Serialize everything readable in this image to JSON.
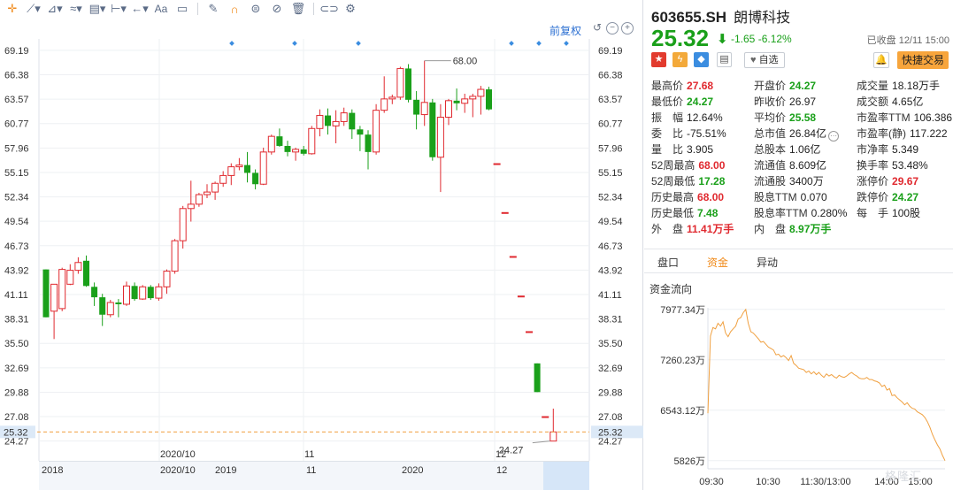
{
  "toolbar": {
    "text_tool": "Aa"
  },
  "chart": {
    "fuquan_label": "前复权",
    "high_label": "68.00",
    "low_label": "24.27",
    "current_price_label": "25.32",
    "up_color": "#e0292f",
    "down_color": "#1aa01a",
    "current_line_color": "#f0a040"
  },
  "timeline": {
    "labels": [
      "2018",
      "2020/10",
      "2019",
      "11",
      "2020",
      "12"
    ]
  },
  "chart_data": {
    "type": "candlestick",
    "y_ticks": [
      "69.19",
      "66.38",
      "63.57",
      "60.77",
      "57.96",
      "55.15",
      "52.34",
      "49.54",
      "46.73",
      "43.92",
      "41.11",
      "38.31",
      "35.50",
      "32.69",
      "29.88",
      "27.08",
      "24.27"
    ],
    "ylim": [
      22.0,
      70.5
    ],
    "x_ticks": [
      "2020/10",
      "11",
      "12"
    ],
    "ohlc": [
      [
        44.0,
        44.0,
        38.5,
        38.5
      ],
      [
        39.2,
        39.5,
        36.0,
        42.3
      ],
      [
        39.5,
        44.2,
        39.2,
        44.0
      ],
      [
        42.3,
        44.6,
        42.2,
        43.9
      ],
      [
        43.9,
        45.4,
        43.5,
        44.8
      ],
      [
        45.0,
        45.6,
        42.0,
        42.1
      ],
      [
        42.0,
        42.5,
        39.8,
        40.8
      ],
      [
        40.8,
        41.2,
        37.5,
        38.8
      ],
      [
        38.8,
        40.5,
        38.5,
        40.2
      ],
      [
        40.2,
        40.6,
        38.5,
        40.0
      ],
      [
        40.0,
        42.6,
        39.8,
        42.1
      ],
      [
        42.1,
        42.5,
        40.4,
        40.6
      ],
      [
        40.6,
        42.2,
        40.5,
        42.0
      ],
      [
        42.0,
        42.2,
        40.5,
        40.7
      ],
      [
        40.7,
        42.4,
        40.4,
        42.0
      ],
      [
        42.0,
        44.0,
        41.2,
        43.8
      ],
      [
        43.8,
        47.5,
        43.5,
        47.3
      ],
      [
        47.3,
        51.3,
        46.4,
        51.0
      ],
      [
        51.0,
        54.2,
        49.5,
        51.5
      ],
      [
        51.5,
        52.8,
        51.2,
        52.6
      ],
      [
        52.6,
        53.8,
        52.2,
        52.9
      ],
      [
        52.9,
        54.1,
        52.0,
        53.9
      ],
      [
        53.9,
        55.3,
        53.5,
        54.8
      ],
      [
        54.8,
        56.2,
        53.7,
        55.8
      ],
      [
        55.8,
        56.8,
        55.4,
        56.0
      ],
      [
        56.0,
        57.5,
        54.0,
        55.1
      ],
      [
        55.1,
        55.5,
        53.2,
        53.8
      ],
      [
        53.8,
        58.0,
        53.7,
        57.5
      ],
      [
        57.5,
        59.5,
        57.2,
        59.3
      ],
      [
        59.3,
        60.2,
        58.1,
        58.2
      ],
      [
        58.2,
        58.8,
        57.0,
        57.5
      ],
      [
        57.5,
        58.0,
        56.5,
        57.8
      ],
      [
        57.8,
        58.2,
        57.1,
        57.3
      ],
      [
        57.3,
        60.5,
        57.2,
        60.2
      ],
      [
        60.2,
        62.4,
        59.3,
        61.7
      ],
      [
        61.7,
        62.5,
        59.5,
        60.5
      ],
      [
        60.5,
        62.3,
        58.5,
        61.0
      ],
      [
        61.0,
        62.6,
        60.5,
        62.0
      ],
      [
        62.0,
        62.4,
        59.0,
        60.1
      ],
      [
        60.1,
        60.5,
        57.6,
        59.5
      ],
      [
        59.5,
        60.0,
        55.5,
        57.5
      ],
      [
        57.5,
        63.0,
        57.2,
        62.3
      ],
      [
        62.3,
        66.2,
        62.0,
        63.6
      ],
      [
        63.6,
        64.1,
        63.0,
        63.8
      ],
      [
        63.8,
        67.3,
        63.5,
        67.1
      ],
      [
        67.1,
        67.6,
        63.2,
        63.5
      ],
      [
        63.5,
        64.5,
        60.1,
        61.8
      ],
      [
        61.8,
        68.0,
        60.5,
        63.2
      ],
      [
        63.2,
        63.6,
        56.5,
        56.9
      ],
      [
        56.9,
        63.0,
        52.9,
        61.5
      ],
      [
        61.5,
        63.6,
        60.6,
        63.4
      ],
      [
        63.4,
        64.8,
        62.3,
        63.1
      ],
      [
        63.1,
        64.2,
        62.0,
        63.6
      ],
      [
        63.6,
        64.2,
        61.5,
        63.9
      ],
      [
        63.9,
        65.1,
        61.8,
        64.7
      ],
      [
        64.7,
        65.0,
        62.3,
        62.4
      ],
      [
        56.16,
        56.16,
        56.16,
        56.16
      ],
      [
        50.54,
        50.54,
        50.54,
        50.54
      ],
      [
        45.49,
        45.49,
        45.49,
        45.49
      ],
      [
        40.94,
        40.94,
        40.94,
        40.94
      ],
      [
        36.85,
        36.85,
        36.85,
        36.85
      ],
      [
        33.2,
        33.2,
        29.9,
        29.9
      ],
      [
        27.08,
        27.08,
        27.08,
        27.08
      ],
      [
        24.27,
        28.0,
        24.27,
        25.32
      ]
    ]
  },
  "quote": {
    "code": "603655.SH",
    "name": "朗博科技",
    "price": "25.32",
    "change": "-1.65",
    "change_pct": "-6.12%",
    "status": "已收盘 12/11 15:00",
    "zixuan": "自选",
    "quick_trade": "快捷交易",
    "rows": [
      [
        [
          "最高价",
          "27.68",
          "red"
        ],
        [
          "开盘价",
          "24.27",
          "green"
        ],
        [
          "成交量",
          "18.18万手",
          "dark"
        ]
      ],
      [
        [
          "最低价",
          "24.27",
          "green"
        ],
        [
          "昨收价",
          "26.97",
          "dark"
        ],
        [
          "成交额",
          "4.65亿",
          "dark"
        ]
      ],
      [
        [
          "振　幅",
          "12.64%",
          "dark"
        ],
        [
          "平均价",
          "25.58",
          "green"
        ],
        [
          "市盈率TTM",
          "106.386",
          "dark"
        ]
      ],
      [
        [
          "委　比",
          "-75.51%",
          "dark"
        ],
        [
          "总市值",
          "26.84亿",
          "dark"
        ],
        [
          "市盈率(静)",
          "117.222",
          "dark"
        ]
      ],
      [
        [
          "量　比",
          "3.905",
          "dark"
        ],
        [
          "总股本",
          "1.06亿",
          "dark"
        ],
        [
          "市净率",
          "5.349",
          "dark"
        ]
      ],
      [
        [
          "52周最高",
          "68.00",
          "red"
        ],
        [
          "流通值",
          "8.609亿",
          "dark"
        ],
        [
          "换手率",
          "53.48%",
          "dark"
        ]
      ],
      [
        [
          "52周最低",
          "17.28",
          "green"
        ],
        [
          "流通股",
          "3400万",
          "dark"
        ],
        [
          "涨停价",
          "29.67",
          "red"
        ]
      ],
      [
        [
          "历史最高",
          "68.00",
          "red"
        ],
        [
          "股息TTM",
          "0.070",
          "dark"
        ],
        [
          "跌停价",
          "24.27",
          "green"
        ]
      ],
      [
        [
          "历史最低",
          "7.48",
          "green"
        ],
        [
          "股息率TTM",
          "0.280%",
          "dark"
        ],
        [
          "每　手",
          "100股",
          "dark"
        ]
      ],
      [
        [
          "外　盘",
          "11.41万手",
          "red"
        ],
        [
          "内　盘",
          "8.97万手",
          "green"
        ],
        [
          "",
          "",
          "dark"
        ]
      ]
    ]
  },
  "tabs": [
    "盘口",
    "资金",
    "异动"
  ],
  "flow": {
    "title": "资金流向",
    "y_ticks": [
      "7977.34万",
      "7260.23万",
      "6543.12万",
      "5826万"
    ],
    "x_ticks": [
      "09:30",
      "10:30",
      "11:30/13:00",
      "14:00",
      "15:00"
    ],
    "line_color": "#f0a040",
    "values": [
      6500,
      7600,
      7720,
      7700,
      7780,
      7740,
      7800,
      7640,
      7590,
      7660,
      7700,
      7740,
      7840,
      7860,
      7930,
      7977,
      7780,
      7660,
      7640,
      7600,
      7560,
      7510,
      7520,
      7480,
      7440,
      7420,
      7400,
      7330,
      7340,
      7300,
      7320,
      7290,
      7250,
      7320,
      7210,
      7180,
      7140,
      7130,
      7120,
      7080,
      7100,
      7060,
      7090,
      7050,
      7080,
      7040,
      7010,
      7060,
      7030,
      7050,
      7020,
      7000,
      7040,
      7020,
      7010,
      7030,
      7060,
      7080,
      7050,
      7030,
      7000,
      6990,
      6990,
      7010,
      6980,
      6980,
      6960,
      6950,
      6930,
      6880,
      6900,
      6830,
      6850,
      6750,
      6760,
      6720,
      6690,
      6660,
      6620,
      6650,
      6600,
      6570,
      6560,
      6520,
      6500,
      6480,
      6440,
      6380,
      6300,
      6200,
      6120,
      6050,
      5990,
      5900,
      5826
    ]
  },
  "watermark": "格隆汇"
}
